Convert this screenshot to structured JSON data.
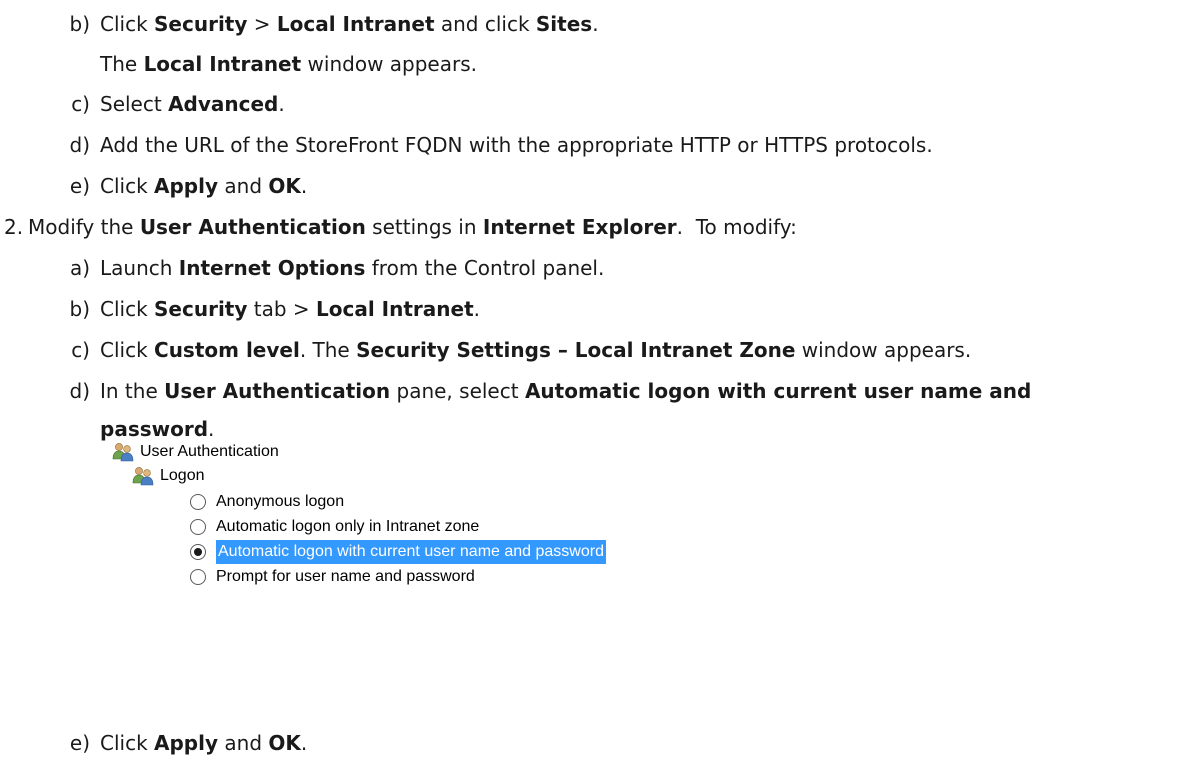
{
  "steps_top": {
    "b": {
      "marker": "b)",
      "t1": "Click ",
      "b1": "Security",
      "t2": " > ",
      "b2": "Local Intranet",
      "t3": " and click ",
      "b3": "Sites",
      "t4": "."
    },
    "b_cont": {
      "b1": "The ",
      "b2": "Local Intranet",
      "t1": " window appears."
    },
    "c": {
      "marker": "c)",
      "t1": "Select ",
      "b1": "Advanced",
      "t2": "."
    },
    "d": {
      "marker": "d)",
      "t1": "Add the URL of the StoreFront FQDN with the appropriate HTTP or HTTPS protocols."
    },
    "e": {
      "marker": "e)",
      "t1": "Click ",
      "b1": "Apply",
      "t2": " and ",
      "b2": "OK",
      "t3": "."
    }
  },
  "step2": {
    "marker": "2.",
    "t1": "Modify the ",
    "b1": "User Authentication",
    "t2": " settings in ",
    "b2": "Internet Explorer",
    "t3": ".  To modify:",
    "a": {
      "marker": "a)",
      "t1": "Launch ",
      "b1": "Internet Options",
      "t2": " from the Control panel."
    },
    "b": {
      "marker": "b)",
      "t1": "Click ",
      "b1": "Security",
      "t2": " tab > ",
      "b2": "Local Intranet",
      "t3": "."
    },
    "c": {
      "marker": "c)",
      "t1": "Click ",
      "b1": "Custom level",
      "t2": ". The ",
      "b2": "Security Settings – Local Intranet Zone",
      "t3": " window appears."
    },
    "d": {
      "marker": "d)",
      "t1": "In the ",
      "b1": "User Authentication",
      "t2": " pane, select ",
      "b2": "Automatic logon with current user name and",
      "b3": "password",
      "t3": "."
    },
    "e": {
      "marker": "e)",
      "t1": "Click ",
      "b1": "Apply",
      "t2": " and ",
      "b2": "OK",
      "t3": "."
    }
  },
  "screenshot": {
    "root_label": "User Authentication",
    "child_label": "Logon",
    "icon": "users-icon",
    "options": [
      {
        "label": "Anonymous logon",
        "checked": false
      },
      {
        "label": "Automatic logon only in Intranet zone",
        "checked": false
      },
      {
        "label": "Automatic logon with current user name and password",
        "checked": true
      },
      {
        "label": "Prompt for user name and password",
        "checked": false
      }
    ],
    "selection_color": "#3399ff"
  }
}
